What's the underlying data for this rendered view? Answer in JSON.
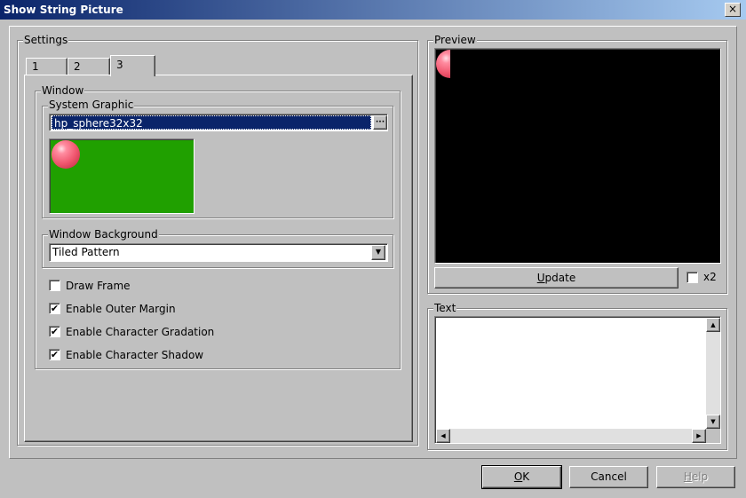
{
  "window": {
    "title": "Show String Picture",
    "close_glyph": "×"
  },
  "settings": {
    "legend": "Settings",
    "tabs": [
      {
        "label": "1",
        "active": false
      },
      {
        "label": "2",
        "active": false
      },
      {
        "label": "3",
        "active": true
      }
    ],
    "window_group": {
      "legend": "Window",
      "system_graphic": {
        "legend": "System Graphic",
        "value": "hp_sphere32x32",
        "browse_glyph": "···",
        "preview_bg": "#20a000"
      },
      "window_background": {
        "legend": "Window Background",
        "value": "Tiled Pattern"
      },
      "checkboxes": [
        {
          "label": "Draw Frame",
          "checked": false,
          "mark": ""
        },
        {
          "label": "Enable Outer Margin",
          "checked": true,
          "mark": "✔"
        },
        {
          "label": "Enable Character Gradation",
          "checked": true,
          "mark": "✔"
        },
        {
          "label": "Enable Character Shadow",
          "checked": true,
          "mark": "✔"
        }
      ]
    }
  },
  "preview": {
    "legend": "Preview",
    "canvas_bg": "#000000",
    "update_label": "Update",
    "x2_label": "x2",
    "x2_checked": false
  },
  "text": {
    "legend": "Text",
    "value": ""
  },
  "footer": {
    "ok_label": "OK",
    "cancel_label": "Cancel",
    "help_label": "Help"
  }
}
